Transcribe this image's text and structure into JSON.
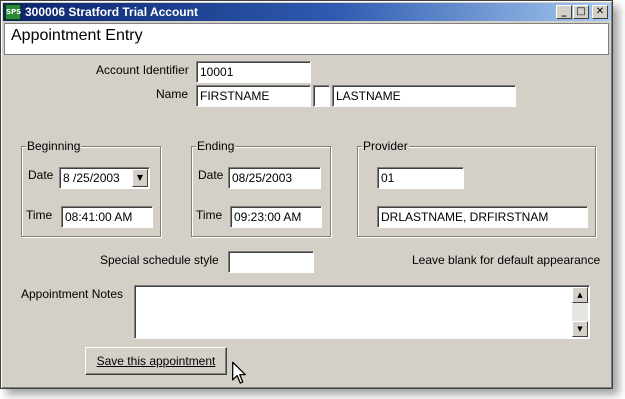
{
  "window": {
    "title": "300006 Stratford Trial Account",
    "app_icon_text": "SPS",
    "minimize_glyph": "_",
    "maximize_glyph": "□",
    "close_glyph": "✕"
  },
  "header": {
    "title": "Appointment Entry"
  },
  "account": {
    "identifier_label": "Account Identifier",
    "identifier_value": "10001",
    "name_label": "Name",
    "first_name": "FIRSTNAME",
    "middle_initial": "",
    "last_name": "LASTNAME"
  },
  "beginning": {
    "legend": "Beginning",
    "date_label": "Date",
    "date_value": "8 /25/2003",
    "time_label": "Time",
    "time_value": "08:41:00 AM"
  },
  "ending": {
    "legend": "Ending",
    "date_label": "Date",
    "date_value": "08/25/2003",
    "time_label": "Time",
    "time_value": "09:23:00 AM"
  },
  "provider": {
    "legend": "Provider",
    "code": "01",
    "name": "DRLASTNAME, DRFIRSTNAM"
  },
  "schedule_style": {
    "label": "Special schedule style",
    "value": "",
    "hint": "Leave blank for default appearance"
  },
  "notes": {
    "label": "Appointment Notes",
    "value": ""
  },
  "save_button": {
    "label": "Save this appointment"
  },
  "icons": {
    "dropdown": "▼",
    "scroll_up": "▲",
    "scroll_down": "▼"
  }
}
